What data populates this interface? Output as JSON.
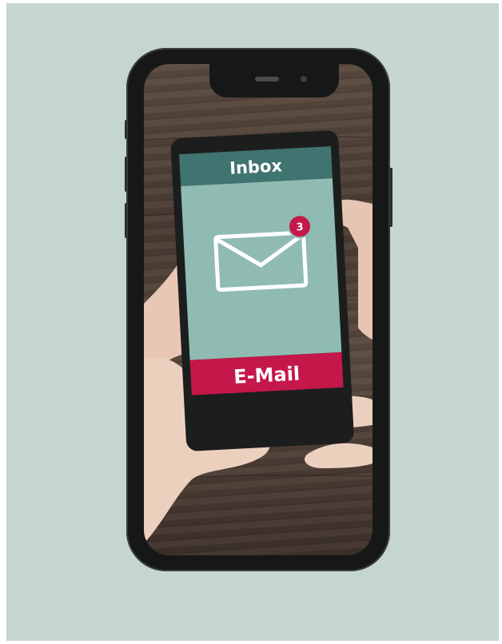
{
  "inner_phone": {
    "header_label": "Inbox",
    "footer_label": "E-Mail",
    "notification_count": "3"
  },
  "colors": {
    "background": "#c4d6ce",
    "header": "#3f7470",
    "screen": "#8fbbb2",
    "footer": "#c4174a",
    "badge": "#c4174a",
    "phone_body": "#161817"
  },
  "icons": [
    "mail-envelope-icon",
    "notification-badge"
  ]
}
